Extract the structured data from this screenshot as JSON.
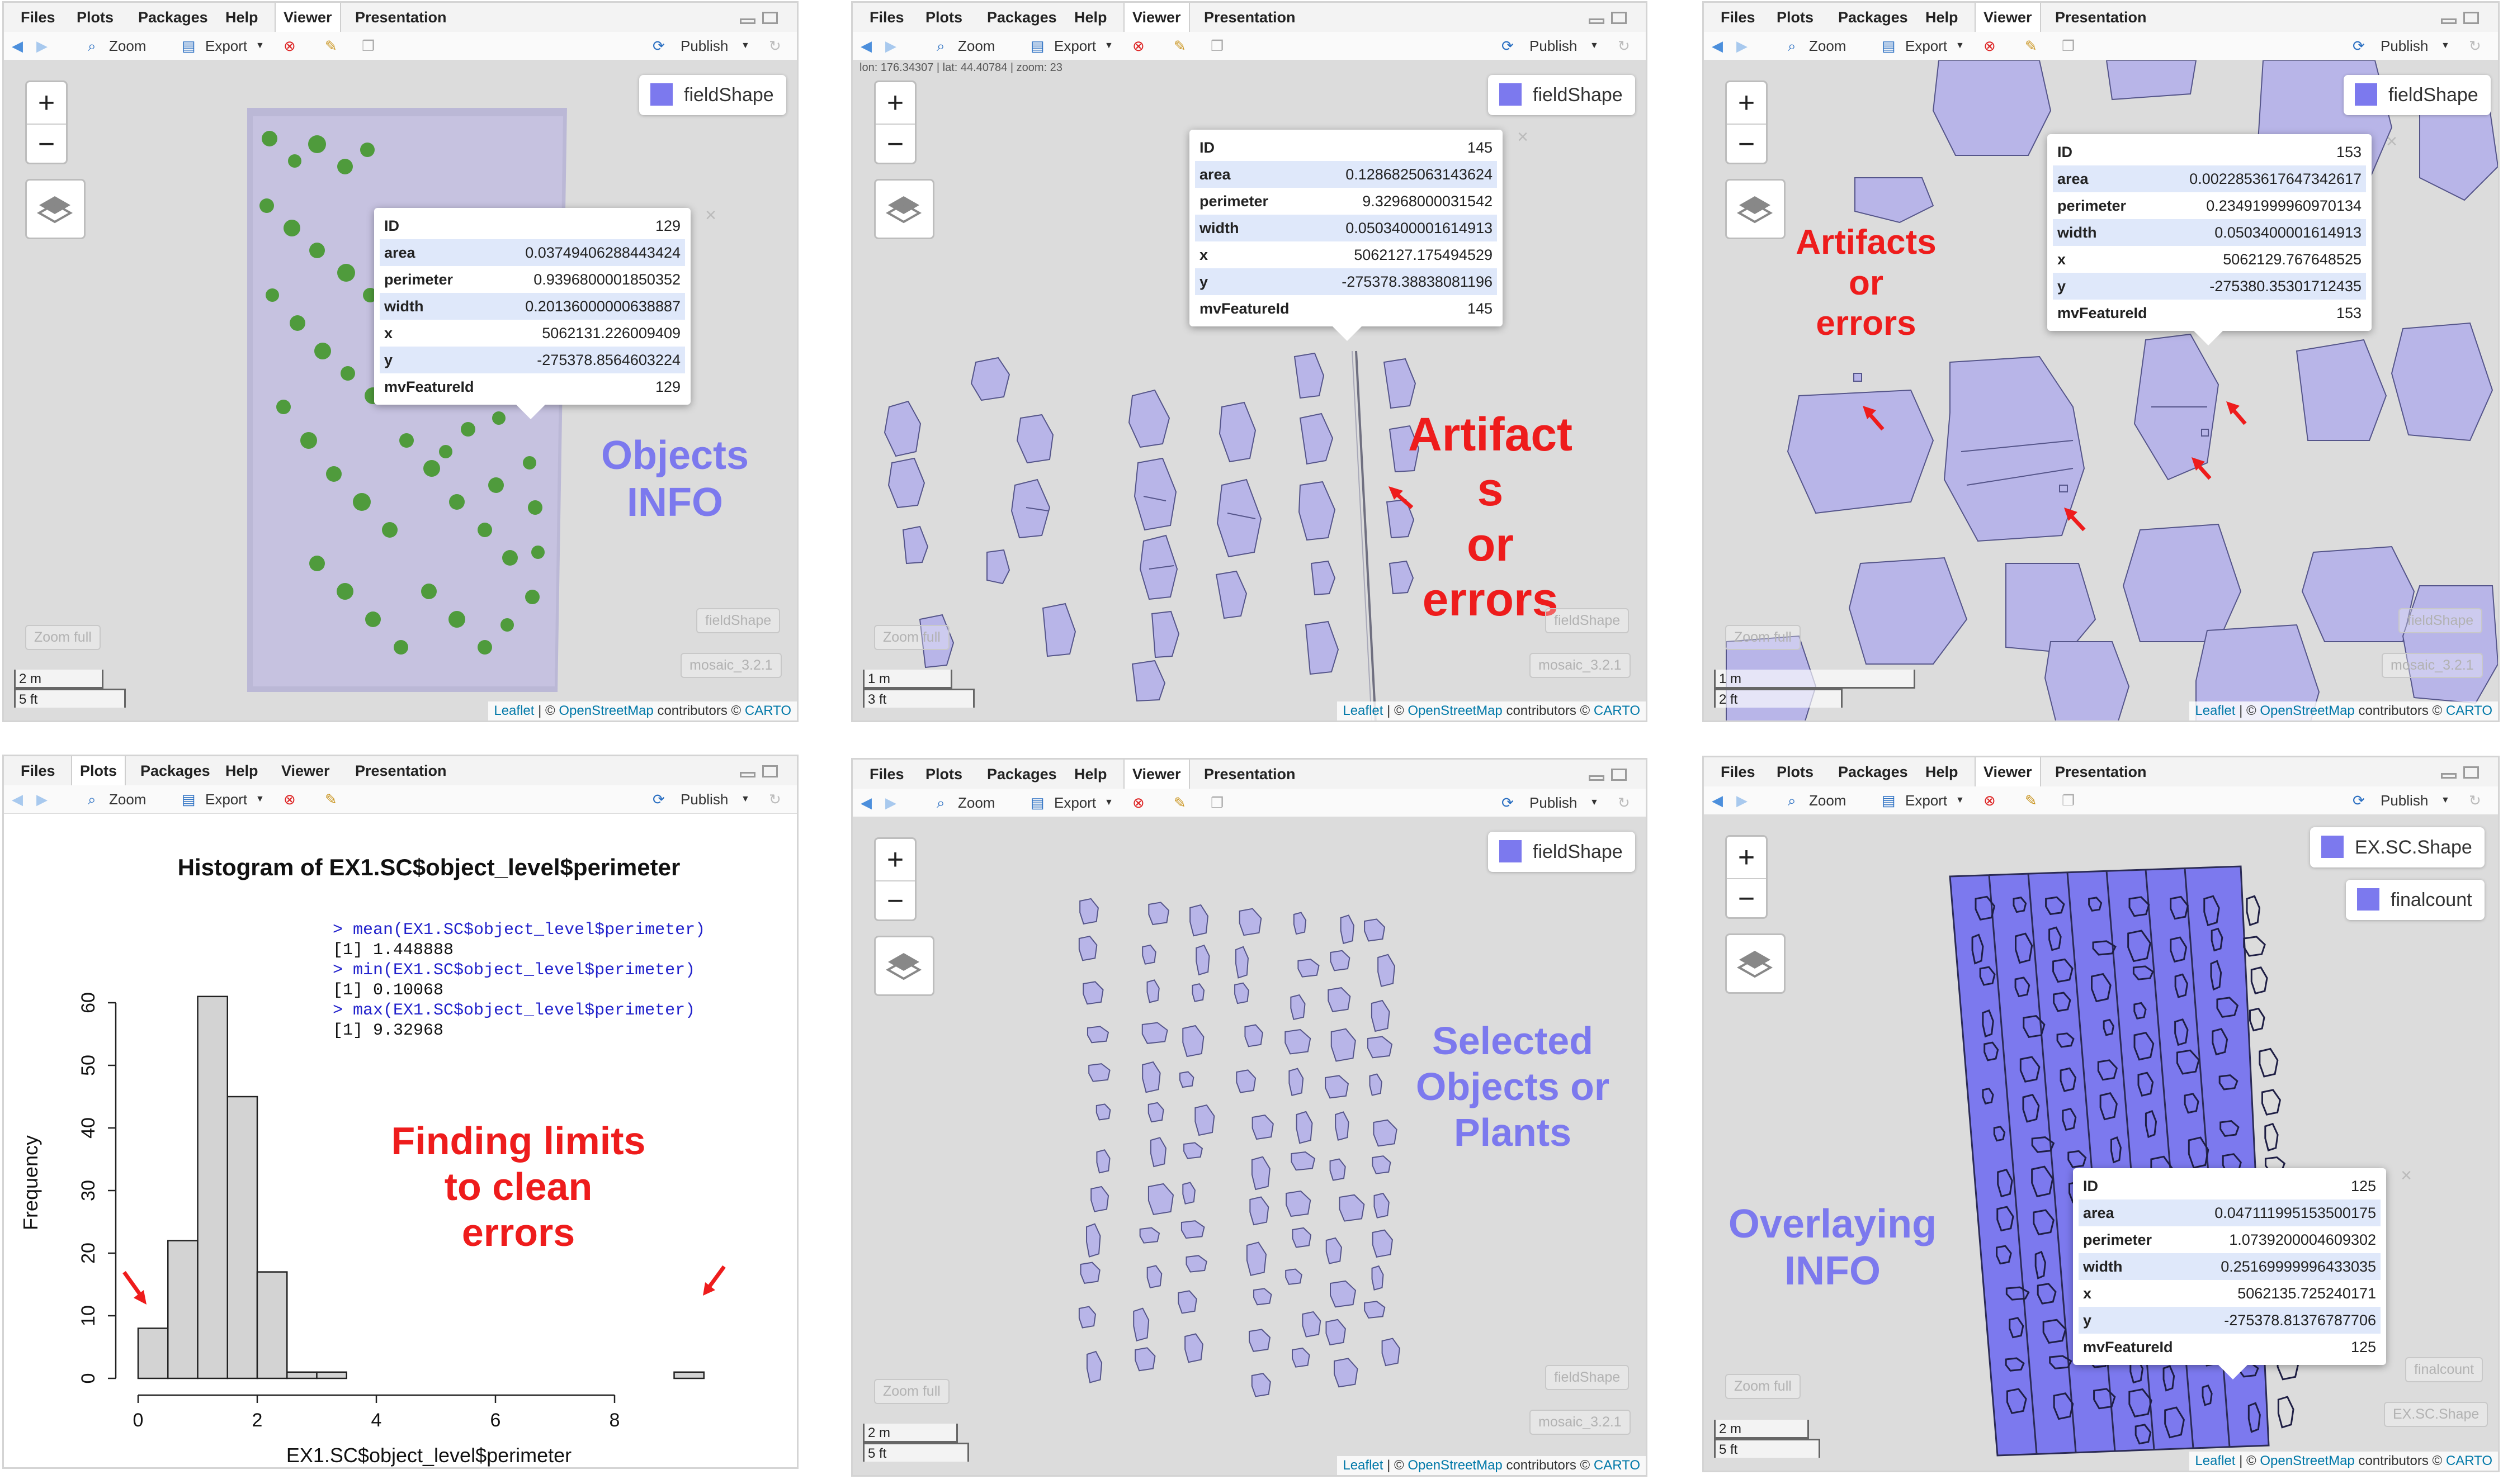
{
  "menu": [
    "Files",
    "Plots",
    "Packages",
    "Help",
    "Viewer",
    "Presentation"
  ],
  "toolbar": {
    "zoom": "Zoom",
    "export": "Export",
    "publish": "Publish"
  },
  "map": {
    "zoom_in": "+",
    "zoom_out": "−",
    "zoom_full": "Zoom full",
    "attribution_link1": "Leaflet",
    "attribution_mid": " | © ",
    "attribution_link2": "OpenStreetMap",
    "attribution_tail": " contributors © ",
    "attribution_link3": "CARTO"
  },
  "colors": {
    "accent": "#7c79ee",
    "annotation_red": "#ee1c1c",
    "map_bg": "#dcdcdc",
    "popup_alt_row": "#dfe8fa"
  },
  "p1": {
    "legend": "fieldShape",
    "faint1": "fieldShape",
    "faint2": "mosaic_3.2.1",
    "scale_m": "2 m",
    "scale_ft": "5 ft",
    "annotation": [
      "Objects",
      "INFO"
    ],
    "popup": [
      [
        "ID",
        "129"
      ],
      [
        "area",
        "0.03749406288443424"
      ],
      [
        "perimeter",
        "0.9396800001850352"
      ],
      [
        "width",
        "0.20136000000638887"
      ],
      [
        "x",
        "5062131.226009409"
      ],
      [
        "y",
        "-275378.8564603224"
      ],
      [
        "mvFeatureId",
        "129"
      ]
    ]
  },
  "p2": {
    "coord": "lon: 176.34307 | lat: 44.40784 | zoom: 23",
    "legend": "fieldShape",
    "faint1": "fieldShape",
    "faint2": "mosaic_3.2.1",
    "scale_m": "1 m",
    "scale_ft": "3 ft",
    "annotation": [
      "Artifact",
      "s",
      "or",
      "errors"
    ],
    "popup": [
      [
        "ID",
        "145"
      ],
      [
        "area",
        "0.1286825063143624"
      ],
      [
        "perimeter",
        "9.32968000031542"
      ],
      [
        "width",
        "0.0503400001614913"
      ],
      [
        "x",
        "5062127.175494529"
      ],
      [
        "y",
        "-275378.38838081196"
      ],
      [
        "mvFeatureId",
        "145"
      ]
    ]
  },
  "p3": {
    "legend": "fieldShape",
    "faint1": "fieldShape",
    "faint2": "mosaic_3.2.1",
    "scale_m": "1 m",
    "scale_ft": "2 ft",
    "annotation": [
      "Artifacts",
      "or",
      "errors"
    ],
    "popup": [
      [
        "ID",
        "153"
      ],
      [
        "area",
        "0.0022853617647342617"
      ],
      [
        "perimeter",
        "0.23491999960970134"
      ],
      [
        "width",
        "0.0503400001614913"
      ],
      [
        "x",
        "5062129.767648525"
      ],
      [
        "y",
        "-275380.35301712435"
      ],
      [
        "mvFeatureId",
        "153"
      ]
    ]
  },
  "p4": {
    "title": "Histogram of EX1.SC$object_level$perimeter",
    "xlabel": "EX1.SC$object_level$perimeter",
    "ylabel": "Frequency",
    "console": [
      {
        "t": "> mean(EX1.SC$object_level$perimeter)",
        "c": "cmd"
      },
      {
        "t": "[1] 1.448888",
        "c": "out"
      },
      {
        "t": "> min(EX1.SC$object_level$perimeter)",
        "c": "cmd"
      },
      {
        "t": "[1] 0.10068",
        "c": "out"
      },
      {
        "t": "> max(EX1.SC$object_level$perimeter)",
        "c": "cmd"
      },
      {
        "t": "[1] 9.32968",
        "c": "out"
      }
    ],
    "annotation": [
      "Finding limits",
      "to clean",
      "errors"
    ]
  },
  "p5": {
    "legend": "fieldShape",
    "faint1": "fieldShape",
    "faint2": "mosaic_3.2.1",
    "scale_m": "2 m",
    "scale_ft": "5 ft",
    "annotation": [
      "Selected",
      "Objects or",
      "Plants"
    ]
  },
  "p6": {
    "legend1": "EX.SC.Shape",
    "legend2": "finalcount",
    "faint1": "finalcount",
    "faint2": "EX.SC.Shape",
    "scale_m": "2 m",
    "scale_ft": "5 ft",
    "annotation": [
      "Overlaying",
      "INFO"
    ],
    "popup": [
      [
        "ID",
        "125"
      ],
      [
        "area",
        "0.047111995153500175"
      ],
      [
        "perimeter",
        "1.0739200004609302"
      ],
      [
        "width",
        "0.25169999996433035"
      ],
      [
        "x",
        "5062135.725240171"
      ],
      [
        "y",
        "-275378.81376787706"
      ],
      [
        "mvFeatureId",
        "125"
      ]
    ]
  },
  "chart_data": {
    "type": "bar",
    "title": "Histogram of EX1.SC$object_level$perimeter",
    "xlabel": "EX1.SC$object_level$perimeter",
    "ylabel": "Frequency",
    "bin_edges": [
      0,
      0.5,
      1,
      1.5,
      2,
      2.5,
      3,
      3.5,
      4,
      4.5,
      5,
      5.5,
      6,
      6.5,
      7,
      7.5,
      8,
      8.5,
      9,
      9.5
    ],
    "values": [
      8,
      22,
      61,
      45,
      17,
      1,
      1,
      0,
      0,
      0,
      0,
      0,
      0,
      0,
      0,
      0,
      0,
      0,
      1
    ],
    "xticks": [
      0,
      2,
      4,
      6,
      8
    ],
    "yticks": [
      0,
      10,
      20,
      30,
      40,
      50,
      60
    ],
    "xlim": [
      0,
      9.5
    ],
    "ylim": [
      0,
      65
    ]
  }
}
